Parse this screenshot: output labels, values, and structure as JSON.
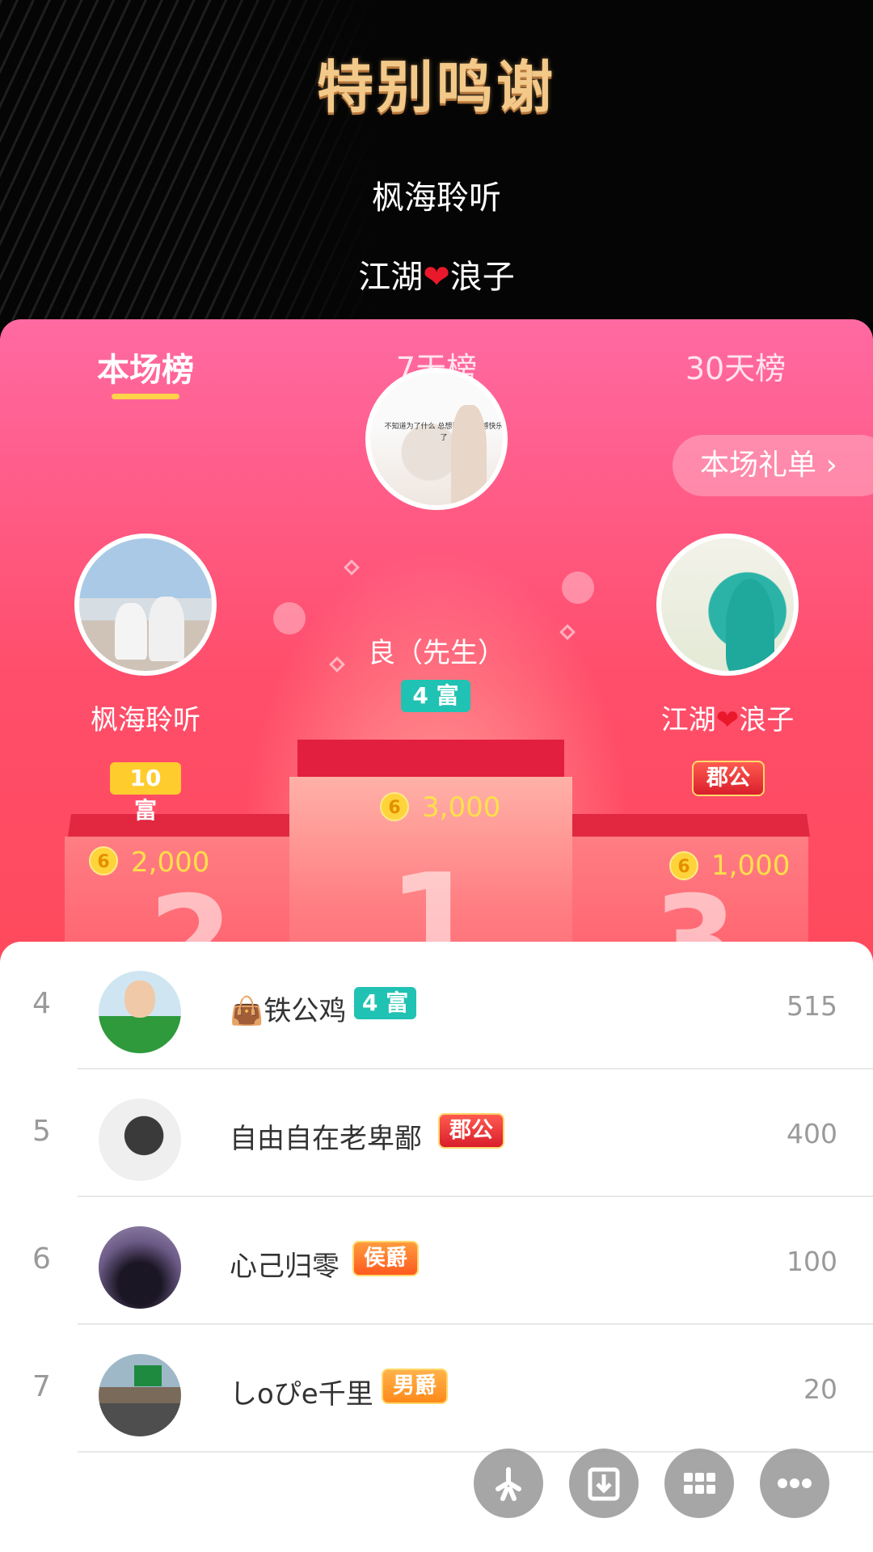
{
  "header": {
    "title": "特别鸣谢",
    "thanks": [
      "枫海聆听",
      "江湖",
      "浪子"
    ]
  },
  "tabs": [
    {
      "label": "本场榜",
      "active": true
    },
    {
      "label": "7天榜",
      "active": false
    },
    {
      "label": "30天榜",
      "active": false
    }
  ],
  "gift_list_button": "本场礼单 ›",
  "podium": {
    "first": {
      "rank": "1",
      "name": "良（先生）",
      "badge": "4 富",
      "score": "3,000"
    },
    "second": {
      "rank": "2",
      "name_a": "枫海聆听",
      "badge": "10 富",
      "score": "2,000"
    },
    "third": {
      "rank": "3",
      "name_a": "江湖",
      "name_b": "浪子",
      "badge": "郡公",
      "score": "1,000"
    },
    "coin_symbol": "6",
    "avatar_text": "不知道为了什么 总想要没有缺憾快乐了"
  },
  "list": [
    {
      "rank": "4",
      "name": "铁公鸡",
      "prefix_icon": "handbag-icon",
      "badge": "4 富",
      "badge_type": "teal",
      "score": "515"
    },
    {
      "rank": "5",
      "name": "自由自在老卑鄙",
      "badge": "郡公",
      "badge_type": "red",
      "score": "400"
    },
    {
      "rank": "6",
      "name": "心己归零",
      "badge": "侯爵",
      "badge_type": "orange",
      "score": "100"
    },
    {
      "rank": "7",
      "name": "しoぴe千里",
      "badge": "男爵",
      "badge_type": "gold",
      "score": "20"
    }
  ],
  "fabs": [
    "share-icon",
    "download-icon",
    "grid-icon",
    "more-icon"
  ],
  "colors": {
    "accent": "#ff5f8e",
    "underline": "#ffd24a",
    "teal_badge": "#20c2b3"
  }
}
